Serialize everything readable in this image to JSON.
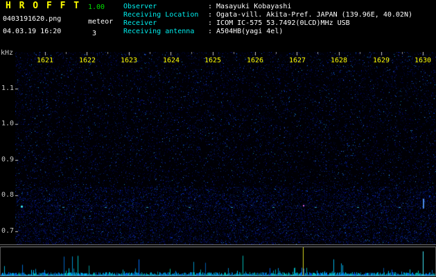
{
  "app": {
    "title": "H R O F F T",
    "version": "1.00",
    "filename": "0403191620.png",
    "mode_label": "meteor",
    "datetime": "04.03.19 16:20",
    "meteor_count": "3"
  },
  "colors": {
    "title_yellow": "#ffff00",
    "version_green": "#00dd00",
    "label_cyan": "#00eeee",
    "value_white": "#ffffff",
    "time_tick_yellow": "#ffff00",
    "noise_blue": "#2233bb",
    "strip_signal_cyan": "#00bbcc",
    "marker_yellow": "#d8d820"
  },
  "info": {
    "colon": ":",
    "rows": [
      {
        "label": "Observer",
        "value": "Masayuki Kobayashi"
      },
      {
        "label": "Receiving Location",
        "value": "Ogata-vill. Akita-Pref. JAPAN (139.96E, 40.02N)"
      },
      {
        "label": "Receiver",
        "value": "ICOM IC-575 53.7492(0LCD)MHz USB"
      },
      {
        "label": "Receiving antenna",
        "value": "A504HB(yagi 4el)"
      }
    ]
  },
  "spectrogram": {
    "ylabel": "kHz",
    "yticks": [
      "1.1",
      "1.0",
      "0.9",
      "0.8",
      "0.7"
    ],
    "xticks": [
      "1621",
      "1622",
      "1623",
      "1624",
      "1625",
      "1626",
      "1627",
      "1628",
      "1629",
      "1630"
    ]
  }
}
